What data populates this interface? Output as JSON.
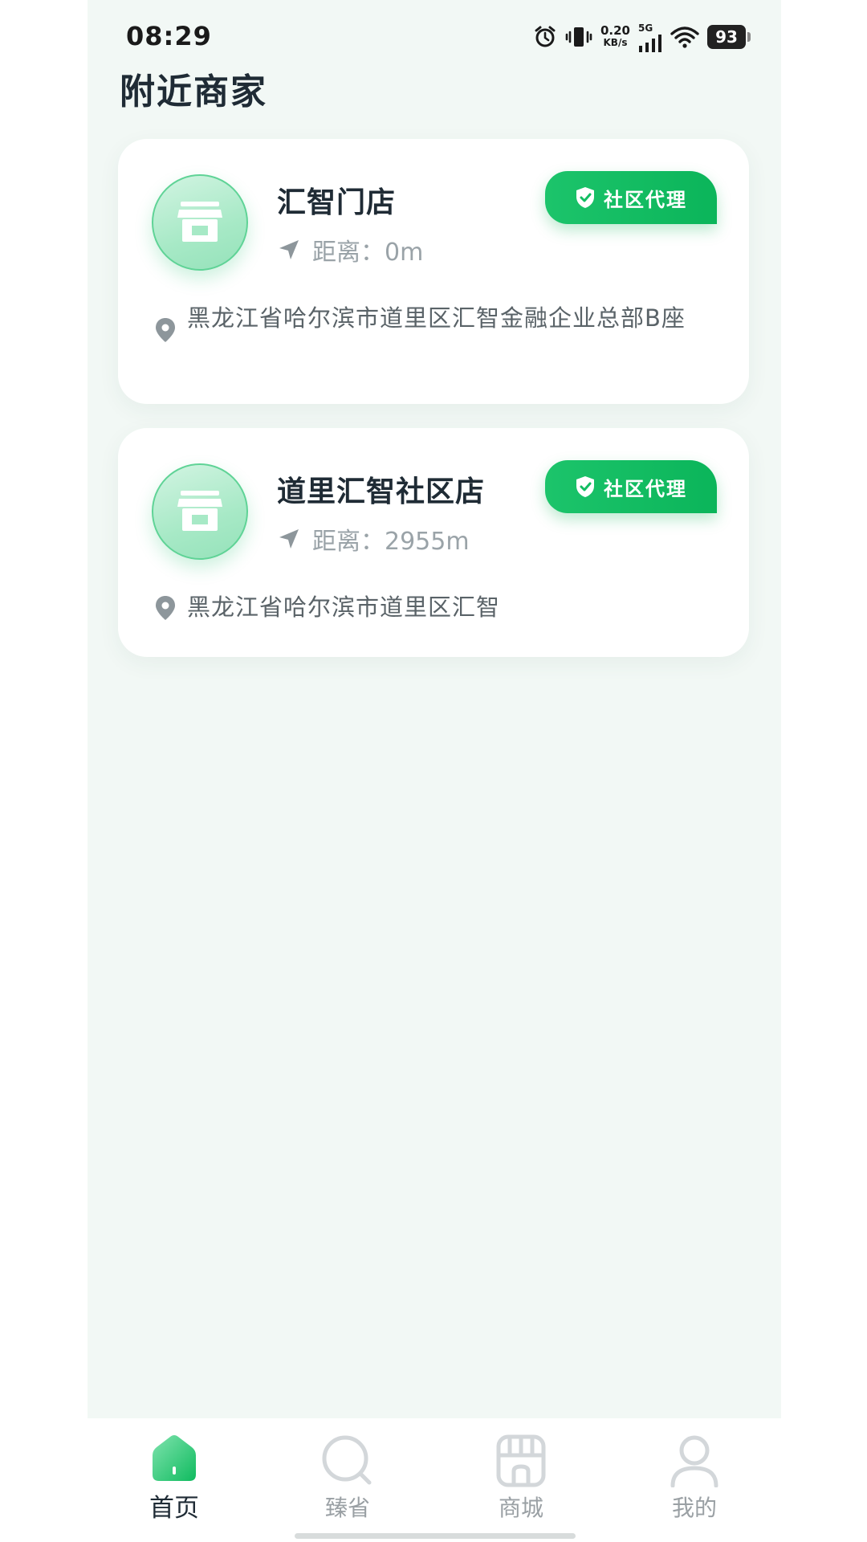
{
  "status_bar": {
    "time": "08:29",
    "net_speed_value": "0.20",
    "net_speed_unit": "KB/s",
    "network_type": "5G",
    "battery_level": "93"
  },
  "page": {
    "title": "附近商家"
  },
  "stores": [
    {
      "name": "汇智门店",
      "badge": "社区代理",
      "distance": "距离：0m",
      "address": "黑龙江省哈尔滨市道里区汇智金融企业总部B座"
    },
    {
      "name": "道里汇智社区店",
      "badge": "社区代理",
      "distance": "距离：2955m",
      "address": "黑龙江省哈尔滨市道里区汇智"
    }
  ],
  "tabs": [
    {
      "label": "首页",
      "icon": "home-icon",
      "active": true
    },
    {
      "label": "臻省",
      "icon": "search-icon",
      "active": false
    },
    {
      "label": "商城",
      "icon": "shop-icon",
      "active": false
    },
    {
      "label": "我的",
      "icon": "user-icon",
      "active": false
    }
  ],
  "colors": {
    "accent": "#0bb55a",
    "page_background": "#f2f8f5",
    "inactive_tab": "#9aa0a4"
  }
}
